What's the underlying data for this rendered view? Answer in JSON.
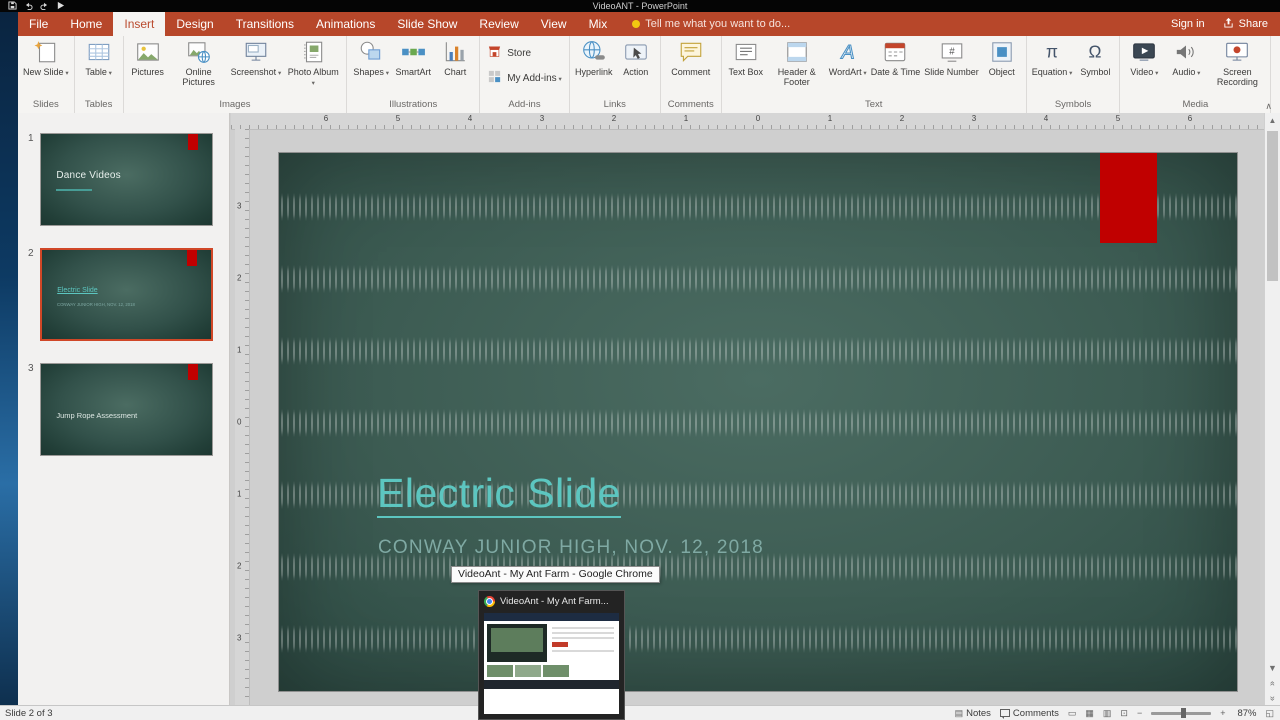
{
  "window": {
    "title": "VideoANT - PowerPoint"
  },
  "tabs": {
    "items": [
      "File",
      "Home",
      "Insert",
      "Design",
      "Transitions",
      "Animations",
      "Slide Show",
      "Review",
      "View",
      "Mix"
    ],
    "active": "Insert",
    "tellme": "Tell me what you want to do...",
    "sign_in": "Sign in",
    "share": "Share"
  },
  "ribbon": {
    "groups": [
      {
        "name": "Slides",
        "buttons": [
          {
            "label": "New Slide"
          }
        ]
      },
      {
        "name": "Tables",
        "buttons": [
          {
            "label": "Table"
          }
        ]
      },
      {
        "name": "Images",
        "buttons": [
          {
            "label": "Pictures"
          },
          {
            "label": "Online Pictures"
          },
          {
            "label": "Screenshot"
          },
          {
            "label": "Photo Album"
          }
        ]
      },
      {
        "name": "Illustrations",
        "buttons": [
          {
            "label": "Shapes"
          },
          {
            "label": "SmartArt"
          },
          {
            "label": "Chart"
          }
        ]
      },
      {
        "name": "Add-ins",
        "buttons": [
          {
            "label": "Store"
          },
          {
            "label": "My Add-ins"
          }
        ]
      },
      {
        "name": "Links",
        "buttons": [
          {
            "label": "Hyperlink"
          },
          {
            "label": "Action"
          }
        ]
      },
      {
        "name": "Comments",
        "buttons": [
          {
            "label": "Comment"
          }
        ]
      },
      {
        "name": "Text",
        "buttons": [
          {
            "label": "Text Box"
          },
          {
            "label": "Header & Footer"
          },
          {
            "label": "WordArt"
          },
          {
            "label": "Date & Time"
          },
          {
            "label": "Slide Number"
          },
          {
            "label": "Object"
          }
        ]
      },
      {
        "name": "Symbols",
        "buttons": [
          {
            "label": "Equation"
          },
          {
            "label": "Symbol"
          }
        ]
      },
      {
        "name": "Media",
        "buttons": [
          {
            "label": "Video"
          },
          {
            "label": "Audio"
          },
          {
            "label": "Screen Recording"
          }
        ]
      }
    ]
  },
  "thumbnails": {
    "items": [
      {
        "number": "1",
        "title": "Dance Videos"
      },
      {
        "number": "2",
        "title": "Electric Slide",
        "subtitle": "CONWAY JUNIOR HIGH, NOV. 12, 2018"
      },
      {
        "number": "3",
        "title": "Jump Rope Assessment"
      }
    ]
  },
  "rulers": {
    "horizontal": [
      "6",
      "5",
      "4",
      "3",
      "2",
      "1",
      "0",
      "1",
      "2",
      "3",
      "4",
      "5",
      "6"
    ],
    "vertical": [
      "3",
      "2",
      "1",
      "0",
      "1",
      "2",
      "3"
    ]
  },
  "slide": {
    "title": "Electric Slide",
    "subtitle": "CONWAY JUNIOR HIGH, NOV. 12, 2018"
  },
  "tooltip": {
    "text": "VideoAnt - My Ant Farm - Google Chrome"
  },
  "taskbar_preview": {
    "title": "VideoAnt - My Ant Farm..."
  },
  "status": {
    "slide_indicator": "Slide 2 of 3",
    "notes": "Notes",
    "comments": "Comments",
    "zoom": "87%"
  },
  "colors": {
    "app_red": "#B7472A",
    "slide_teal": "#5CC6C0",
    "accent_rect_red": "#C00000",
    "slide_bg_center": "#4B6C62",
    "slide_bg_edge": "#203B34"
  }
}
